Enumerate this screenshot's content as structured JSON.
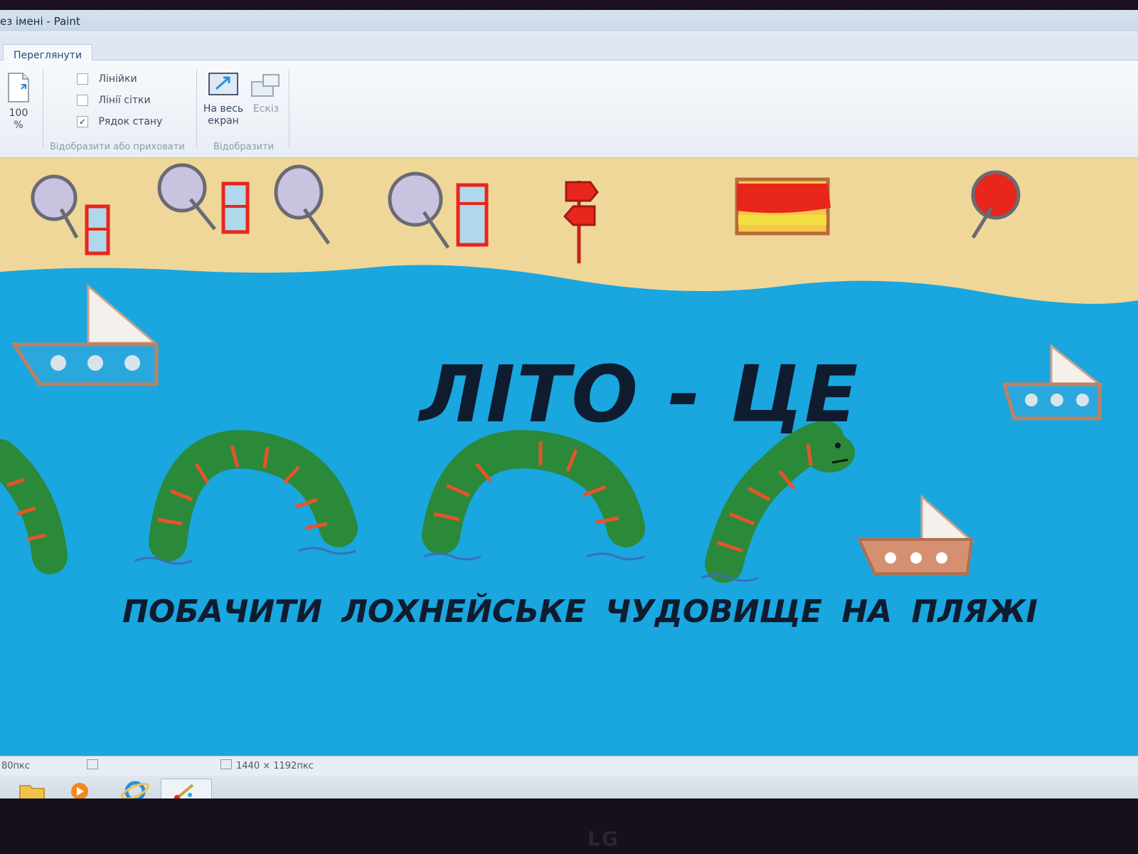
{
  "window": {
    "title": "ез імені - Paint"
  },
  "tabs": [
    {
      "label": "Переглянути"
    }
  ],
  "ribbon": {
    "zoom": {
      "value": "100",
      "unit": "%"
    },
    "checkboxes": [
      {
        "label": "Лінійки",
        "checked": false
      },
      {
        "label": "Лінії сітки",
        "checked": false
      },
      {
        "label": "Рядок стану",
        "checked": true
      }
    ],
    "group_show_hide": "Відобразити або приховати",
    "fullscreen": {
      "line1": "На весь",
      "line2": "екран"
    },
    "thumbnail": "Ескіз",
    "group_display": "Відобразити",
    "checkmark": "✓"
  },
  "canvas": {
    "headline": "ЛІТО - ЦЕ",
    "subline": "ПОБАЧИТИ  ЛОХНЕЙСЬКЕ  ЧУДОВИЩЕ  НА  ПЛЯЖІ",
    "colors": {
      "sand": "#efd79a",
      "sea": "#1aa6de",
      "monster": "#2a8a3a",
      "stripe": "#e8532a",
      "red": "#e8261c"
    }
  },
  "status": {
    "position": "80пкс",
    "dimensions": "1440 × 1192пкс"
  },
  "taskbar": {
    "items": [
      {
        "icon": "folder-icon"
      },
      {
        "icon": "media-player-icon"
      },
      {
        "icon": "internet-explorer-icon"
      },
      {
        "icon": "paint-icon"
      }
    ]
  },
  "monitor": {
    "brand": "LG"
  }
}
